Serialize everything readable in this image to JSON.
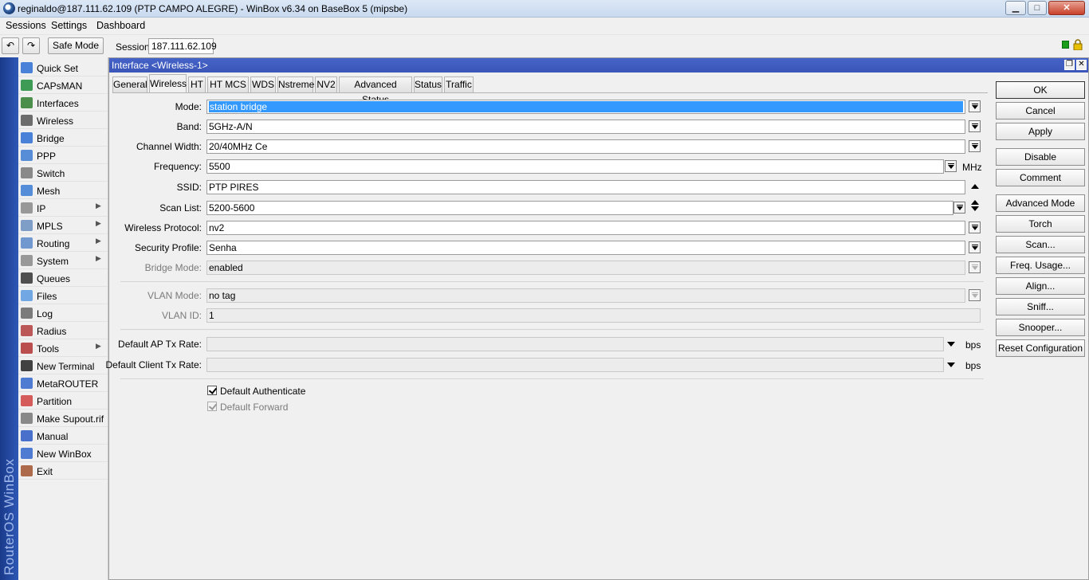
{
  "window": {
    "title": "reginaldo@187.111.62.109 (PTP CAMPO ALEGRE) - WinBox v6.34 on BaseBox 5 (mipsbe)",
    "min": "▁",
    "max": "□",
    "close": "✕"
  },
  "menu": {
    "sessions": "Sessions",
    "settings": "Settings",
    "dashboard": "Dashboard"
  },
  "toolbar": {
    "undo": "↶",
    "redo": "↷",
    "safe_mode": "Safe Mode",
    "session_label": "Session:",
    "session_value": "187.111.62.109"
  },
  "brand_vertical": "RouterOS WinBox",
  "sidebar": [
    {
      "label": "Quick Set",
      "icon": "quick-set-icon",
      "submenu": false
    },
    {
      "label": "CAPsMAN",
      "icon": "capsman-icon",
      "submenu": false
    },
    {
      "label": "Interfaces",
      "icon": "interfaces-icon",
      "submenu": false
    },
    {
      "label": "Wireless",
      "icon": "wireless-icon",
      "submenu": false
    },
    {
      "label": "Bridge",
      "icon": "bridge-icon",
      "submenu": false
    },
    {
      "label": "PPP",
      "icon": "ppp-icon",
      "submenu": false
    },
    {
      "label": "Switch",
      "icon": "switch-icon",
      "submenu": false
    },
    {
      "label": "Mesh",
      "icon": "mesh-icon",
      "submenu": false
    },
    {
      "label": "IP",
      "icon": "ip-icon",
      "submenu": true
    },
    {
      "label": "MPLS",
      "icon": "mpls-icon",
      "submenu": true
    },
    {
      "label": "Routing",
      "icon": "routing-icon",
      "submenu": true
    },
    {
      "label": "System",
      "icon": "system-icon",
      "submenu": true
    },
    {
      "label": "Queues",
      "icon": "queues-icon",
      "submenu": false
    },
    {
      "label": "Files",
      "icon": "files-icon",
      "submenu": false
    },
    {
      "label": "Log",
      "icon": "log-icon",
      "submenu": false
    },
    {
      "label": "Radius",
      "icon": "radius-icon",
      "submenu": false
    },
    {
      "label": "Tools",
      "icon": "tools-icon",
      "submenu": true
    },
    {
      "label": "New Terminal",
      "icon": "terminal-icon",
      "submenu": false
    },
    {
      "label": "MetaROUTER",
      "icon": "metarouter-icon",
      "submenu": false
    },
    {
      "label": "Partition",
      "icon": "partition-icon",
      "submenu": false
    },
    {
      "label": "Make Supout.rif",
      "icon": "supout-icon",
      "submenu": false
    },
    {
      "label": "Manual",
      "icon": "manual-icon",
      "submenu": false
    },
    {
      "label": "New WinBox",
      "icon": "new-winbox-icon",
      "submenu": false
    },
    {
      "label": "Exit",
      "icon": "exit-icon",
      "submenu": false
    }
  ],
  "submenu_arrow": "▶",
  "interface_window": {
    "title": "Interface <Wireless-1>",
    "restore": "❐",
    "close": "✕",
    "tabs": [
      "General",
      "Wireless",
      "HT",
      "HT MCS",
      "WDS",
      "Nstreme",
      "NV2",
      "Advanced Status",
      "Status",
      "Traffic"
    ],
    "active_tab": "Wireless",
    "fields": {
      "mode": {
        "label": "Mode:",
        "value": "station bridge"
      },
      "band": {
        "label": "Band:",
        "value": "5GHz-A/N"
      },
      "channel_width": {
        "label": "Channel Width:",
        "value": "20/40MHz Ce"
      },
      "frequency": {
        "label": "Frequency:",
        "value": "5500",
        "unit": "MHz"
      },
      "ssid": {
        "label": "SSID:",
        "value": "PTP PIRES"
      },
      "scan_list": {
        "label": "Scan List:",
        "value": "5200-5600"
      },
      "wireless_protocol": {
        "label": "Wireless Protocol:",
        "value": "nv2"
      },
      "security_profile": {
        "label": "Security Profile:",
        "value": "Senha"
      },
      "bridge_mode": {
        "label": "Bridge Mode:",
        "value": "enabled"
      },
      "vlan_mode": {
        "label": "VLAN Mode:",
        "value": "no tag"
      },
      "vlan_id": {
        "label": "VLAN ID:",
        "value": "1"
      },
      "default_ap_tx_rate": {
        "label": "Default AP Tx Rate:",
        "value": "",
        "unit": "bps"
      },
      "default_client_tx_rate": {
        "label": "Default Client Tx Rate:",
        "value": "",
        "unit": "bps"
      }
    },
    "checkboxes": {
      "default_authenticate": {
        "label": "Default Authenticate",
        "checked": true
      },
      "default_forward": {
        "label": "Default Forward",
        "checked": true
      }
    },
    "buttons": [
      "OK",
      "Cancel",
      "Apply",
      "Disable",
      "Comment",
      "Advanced Mode",
      "Torch",
      "Scan...",
      "Freq. Usage...",
      "Align...",
      "Sniff...",
      "Snooper...",
      "Reset Configuration"
    ]
  },
  "colors": {
    "header_blue": "#3b56b8",
    "side_bar_blue": "#1a3a8a",
    "selection": "#3399ff",
    "status_green": "#1b9d1b"
  }
}
